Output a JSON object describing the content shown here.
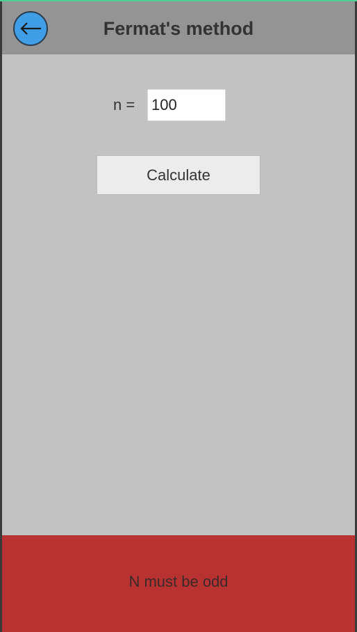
{
  "header": {
    "title": "Fermat's method",
    "back_icon": "arrow-left-icon"
  },
  "form": {
    "n_label": "n =",
    "n_value": "100",
    "calculate_label": "Calculate"
  },
  "error": {
    "message": "N must be odd"
  },
  "colors": {
    "header_bg": "#949494",
    "screen_bg": "#c2c2c2",
    "back_button": "#3f9ee6",
    "error_bg": "#b83232"
  }
}
